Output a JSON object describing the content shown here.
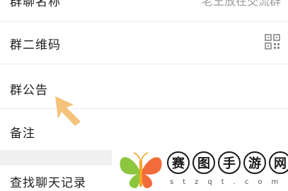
{
  "rows": {
    "group_name": {
      "label": "群聊名称",
      "value": "老王放在交流群"
    },
    "group_qr": {
      "label": "群二维码",
      "icon": "qr-code-icon"
    },
    "group_notice": {
      "label": "群公告"
    },
    "remark": {
      "label": "备注"
    },
    "search_history": {
      "label": "查找聊天记录"
    }
  },
  "pointer": {
    "icon": "arrow-pointer-icon",
    "color": "#f4c27a"
  },
  "watermark": {
    "chars": [
      "赛",
      "图",
      "手",
      "游",
      "网"
    ],
    "domain": "stzqt.com",
    "logo": "butterfly-logo",
    "colors": {
      "left_wing": "#8cc63f",
      "right_wing": "#f26b3a",
      "body": "#f5a623"
    }
  }
}
